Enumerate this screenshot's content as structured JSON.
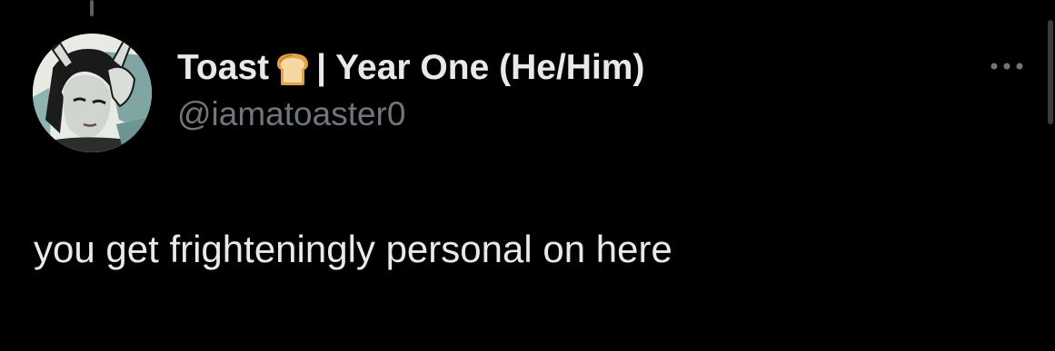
{
  "tweet": {
    "display_name": "Toast",
    "name_suffix": "| Year One (He/Him)",
    "handle": "@iamatoaster0",
    "text": "you get frighteningly personal on here"
  },
  "icons": {
    "name_emoji": "bread-emoji-icon",
    "more": "more-horizontal-icon",
    "avatar": "avatar-image"
  },
  "colors": {
    "background": "#000000",
    "primary_text": "#e7e9ea",
    "secondary_text": "#71767b"
  }
}
